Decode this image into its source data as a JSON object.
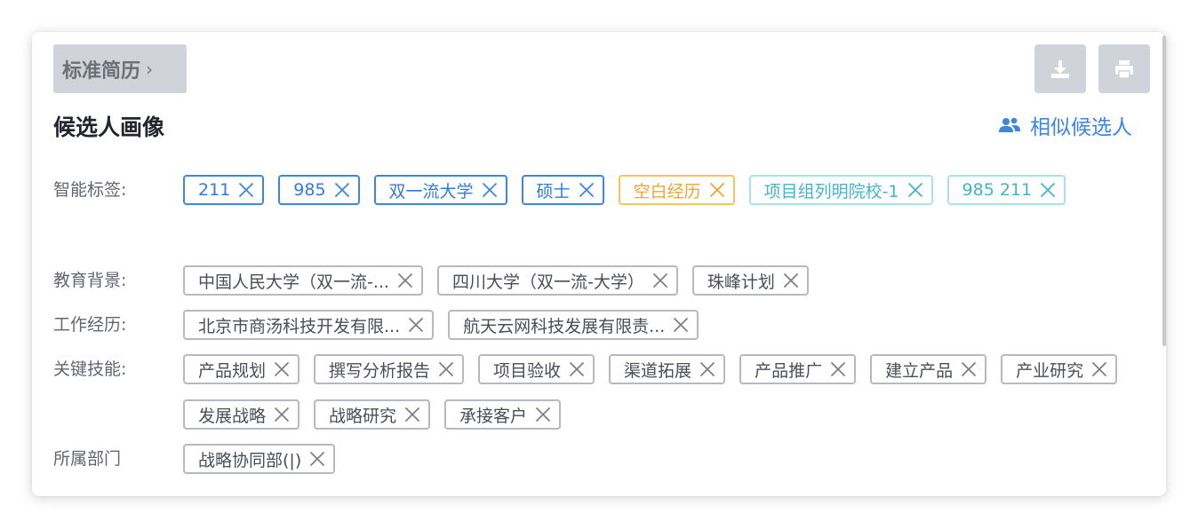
{
  "header": {
    "resume_button": "标准简历",
    "resume_chevron": "›",
    "download_icon": "download-icon",
    "print_icon": "print-icon"
  },
  "title": "候选人画像",
  "similar_link": {
    "icon": "users-icon",
    "label": "相似候选人"
  },
  "colors": {
    "blue": "#3e86e3",
    "orange": "#f5c55d",
    "teal": "#a9e3ea",
    "gray_border": "#b6b9bf",
    "button_bg": "#d0d3d9"
  },
  "sections": [
    {
      "label": "智能标签:",
      "tags": [
        {
          "text": "211",
          "color": "blue"
        },
        {
          "text": "985",
          "color": "blue"
        },
        {
          "text": "双一流大学",
          "color": "blue"
        },
        {
          "text": "硕士",
          "color": "blue"
        },
        {
          "text": "空白经历",
          "color": "orange"
        },
        {
          "text": "项目组列明院校-1",
          "color": "teal"
        },
        {
          "text": "985 211",
          "color": "teal"
        }
      ]
    },
    {
      "label": "教育背景:",
      "tags": [
        {
          "text": "中国人民大学（双一流-...",
          "color": "gray"
        },
        {
          "text": "四川大学（双一流-大学）",
          "color": "gray"
        },
        {
          "text": "珠峰计划",
          "color": "gray"
        }
      ]
    },
    {
      "label": "工作经历:",
      "tags": [
        {
          "text": "北京市商汤科技开发有限...",
          "color": "gray"
        },
        {
          "text": "航天云网科技发展有限责...",
          "color": "gray"
        }
      ]
    },
    {
      "label": "关键技能:",
      "tags": [
        {
          "text": "产品规划",
          "color": "gray"
        },
        {
          "text": "撰写分析报告",
          "color": "gray"
        },
        {
          "text": "项目验收",
          "color": "gray"
        },
        {
          "text": "渠道拓展",
          "color": "gray"
        },
        {
          "text": "产品推广",
          "color": "gray"
        },
        {
          "text": "建立产品",
          "color": "gray"
        },
        {
          "text": "产业研究",
          "color": "gray"
        },
        {
          "text": "发展战略",
          "color": "gray"
        },
        {
          "text": "战略研究",
          "color": "gray"
        },
        {
          "text": "承接客户",
          "color": "gray"
        }
      ]
    },
    {
      "label": "所属部门",
      "tags": [
        {
          "text": "战略协同部(|)",
          "color": "gray"
        }
      ]
    }
  ]
}
